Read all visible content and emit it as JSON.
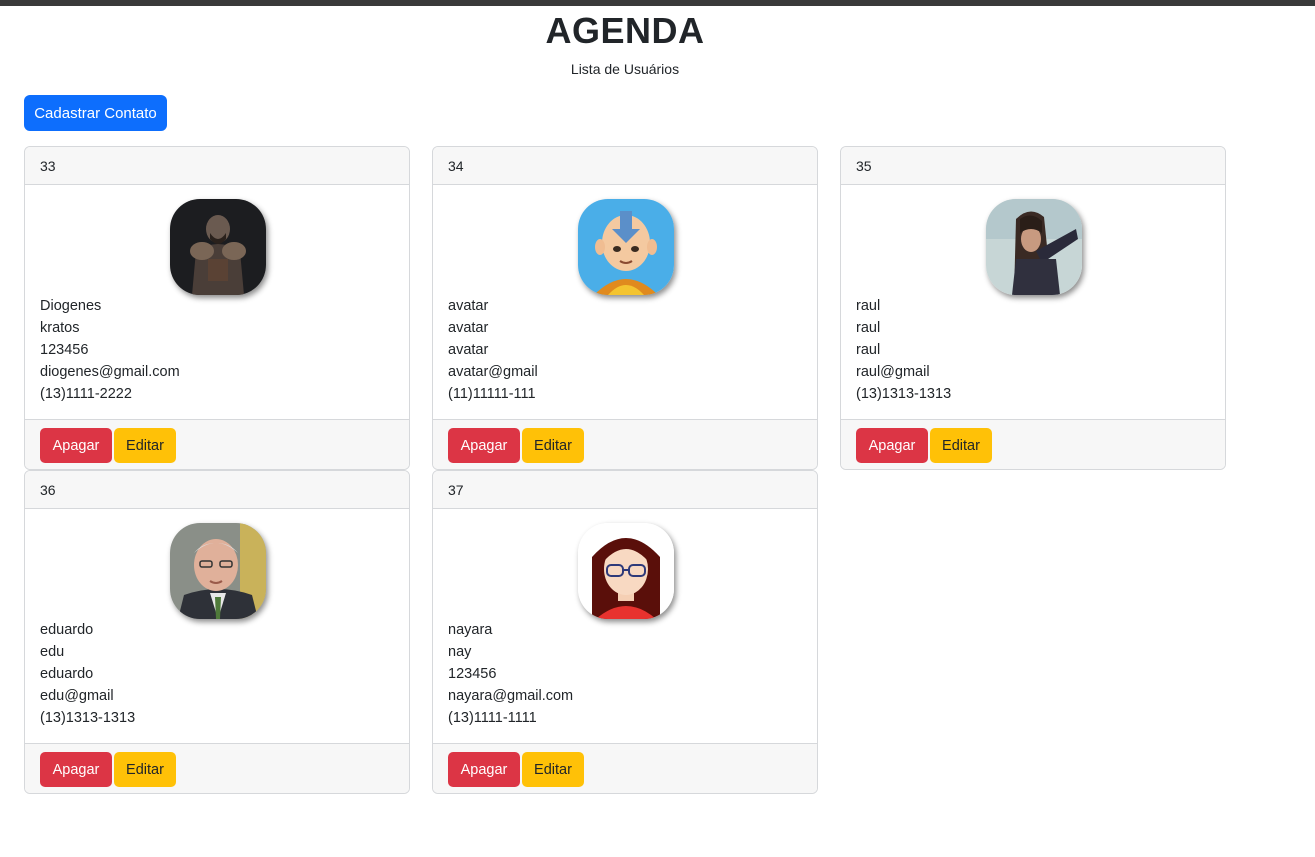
{
  "header": {
    "title": "AGENDA",
    "subtitle": "Lista de Usuários"
  },
  "actions": {
    "add_contact_label": "Cadastrar Contato"
  },
  "colors": {
    "primary": "#0d6efd",
    "danger": "#dc3545",
    "warning": "#ffc107"
  },
  "contacts": [
    {
      "id": "33",
      "avatar": "warrior-avatar",
      "name": "Diogenes",
      "nickname": "kratos",
      "field3": "123456",
      "email": "diogenes@gmail.com",
      "phone": "(13)1111-2222",
      "delete_label": "Apagar",
      "edit_label": "Editar"
    },
    {
      "id": "34",
      "avatar": "cartoon-boy-avatar",
      "name": "avatar",
      "nickname": "avatar",
      "field3": "avatar",
      "email": "avatar@gmail",
      "phone": "(11)11111-111",
      "delete_label": "Apagar",
      "edit_label": "Editar"
    },
    {
      "id": "35",
      "avatar": "man-long-hair-avatar",
      "name": "raul",
      "nickname": "raul",
      "field3": "raul",
      "email": "raul@gmail",
      "phone": "(13)1313-1313",
      "delete_label": "Apagar",
      "edit_label": "Editar"
    },
    {
      "id": "36",
      "avatar": "older-man-avatar",
      "name": "eduardo",
      "nickname": "edu",
      "field3": "eduardo",
      "email": "edu@gmail",
      "phone": "(13)1313-1313",
      "delete_label": "Apagar",
      "edit_label": "Editar"
    },
    {
      "id": "37",
      "avatar": "woman-glasses-avatar",
      "name": "nayara",
      "nickname": "nay",
      "field3": "123456",
      "email": "nayara@gmail.com",
      "phone": "(13)1111-1111",
      "delete_label": "Apagar",
      "edit_label": "Editar"
    }
  ]
}
